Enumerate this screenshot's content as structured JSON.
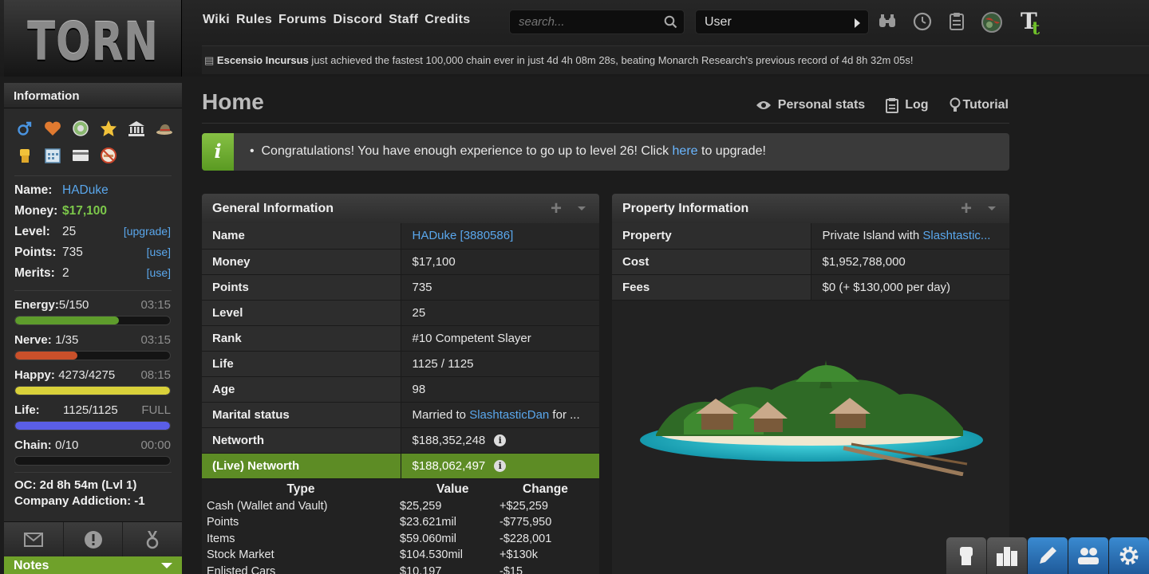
{
  "logo": {
    "text": "TORN"
  },
  "nav": {
    "items": [
      "Wiki",
      "Rules",
      "Forums",
      "Discord",
      "Staff",
      "Credits"
    ]
  },
  "search": {
    "placeholder": "search..."
  },
  "user_select": {
    "value": "User"
  },
  "header_icons": [
    "binoculars-icon",
    "clock-icon",
    "clipboard-icon",
    "globe-icon",
    "tt-icon"
  ],
  "news": {
    "name": "Escensio Incursus",
    "text": " just achieved the fastest 100,000 chain ever in just 4d 4h 08m 28s, beating Monarch Research's previous record of 4d 8h 32m 05s!"
  },
  "sidebar": {
    "title": "Information",
    "icons": [
      "male-icon",
      "heart-icon",
      "donator-icon",
      "star-icon",
      "bank-icon",
      "hat-icon",
      "fist-icon",
      "calendar-icon",
      "card-icon",
      "no-smoking-icon"
    ],
    "name_label": "Name:",
    "name_value": "HADuke",
    "money_label": "Money:",
    "money_value": "$17,100",
    "level_label": "Level:",
    "level_value": "25",
    "level_action": "[upgrade]",
    "points_label": "Points:",
    "points_value": "735",
    "points_action": "[use]",
    "merits_label": "Merits:",
    "merits_value": "2",
    "merits_action": "[use]",
    "bars": {
      "energy": {
        "label": "Energy:",
        "value": "5/150",
        "time": "03:15",
        "fraction": 0.67,
        "color": "#5e9c2c"
      },
      "nerve": {
        "label": "Nerve:",
        "value": "1/35",
        "time": "03:15",
        "fraction": 0.4,
        "color": "#c9502a"
      },
      "happy": {
        "label": "Happy:",
        "value": "4273/4275",
        "time": "08:15",
        "fraction": 1.0,
        "color": "#d9d13a"
      },
      "life": {
        "label": "Life:",
        "value": "1125/1125",
        "time": "FULL",
        "fraction": 1.0,
        "color": "#5a5ee6"
      },
      "chain": {
        "label": "Chain:",
        "value": "0/10",
        "time": "00:00",
        "fraction": 0.0,
        "color": "#888888"
      }
    },
    "oc": "OC: 2d 8h 54m (Lvl 1)",
    "company": "Company Addiction: -1",
    "notes": "Notes"
  },
  "page": {
    "title": "Home",
    "links": {
      "stats": "Personal stats",
      "log": "Log",
      "tutorial": "Tutorial"
    }
  },
  "message": {
    "icon": "i",
    "text_before": "Congratulations! You have enough experience to go up to level 26! Click ",
    "link": "here",
    "text_after": " to upgrade!"
  },
  "general": {
    "title": "General Information",
    "rows": [
      {
        "key": "Name",
        "value": "HADuke [3880586]",
        "link": true
      },
      {
        "key": "Money",
        "value": "$17,100"
      },
      {
        "key": "Points",
        "value": "735"
      },
      {
        "key": "Level",
        "value": "25"
      },
      {
        "key": "Rank",
        "value": "#10 Competent Slayer"
      },
      {
        "key": "Life",
        "value": "1125 / 1125"
      },
      {
        "key": "Age",
        "value": "98"
      },
      {
        "key": "Marital status",
        "value_before": "Married to ",
        "value_link": "SlashtasticDan",
        "value_after": " for ..."
      },
      {
        "key": "Networth",
        "value": "$188,352,248"
      },
      {
        "key": "(Live) Networth",
        "value": "$188,062,497"
      }
    ],
    "networth_headers": [
      "Type",
      "Value",
      "Change"
    ],
    "networth_rows": [
      {
        "type": "Cash (Wallet and Vault)",
        "value": "$25,259",
        "change": "+$25,259",
        "dir": "pos"
      },
      {
        "type": "Points",
        "value": "$23.621mil",
        "change": "-$775,950",
        "dir": "neg"
      },
      {
        "type": "Items",
        "value": "$59.060mil",
        "change": "-$228,001",
        "dir": "neg"
      },
      {
        "type": "Stock Market",
        "value": "$104.530mil",
        "change": "+$130k",
        "dir": "pos"
      },
      {
        "type": "Enlisted Cars",
        "value": "$10,197",
        "change": "-$15",
        "dir": "neg"
      }
    ]
  },
  "property": {
    "title": "Property Information",
    "rows": [
      {
        "key": "Property",
        "value_before": "Private Island with ",
        "value_link": "Slashtastic..."
      },
      {
        "key": "Cost",
        "value": "$1,952,788,000"
      },
      {
        "key": "Fees",
        "value": "$0 (+ $130,000 per day)"
      }
    ]
  },
  "quick_buttons": [
    "fist-icon",
    "city-icon",
    "pencil-icon",
    "friends-icon",
    "settings-icon"
  ],
  "colors": {
    "accent_green": "#6fa12a",
    "link_blue": "#5aa7ec",
    "positive": "#38b02a",
    "negative": "#d53620"
  }
}
